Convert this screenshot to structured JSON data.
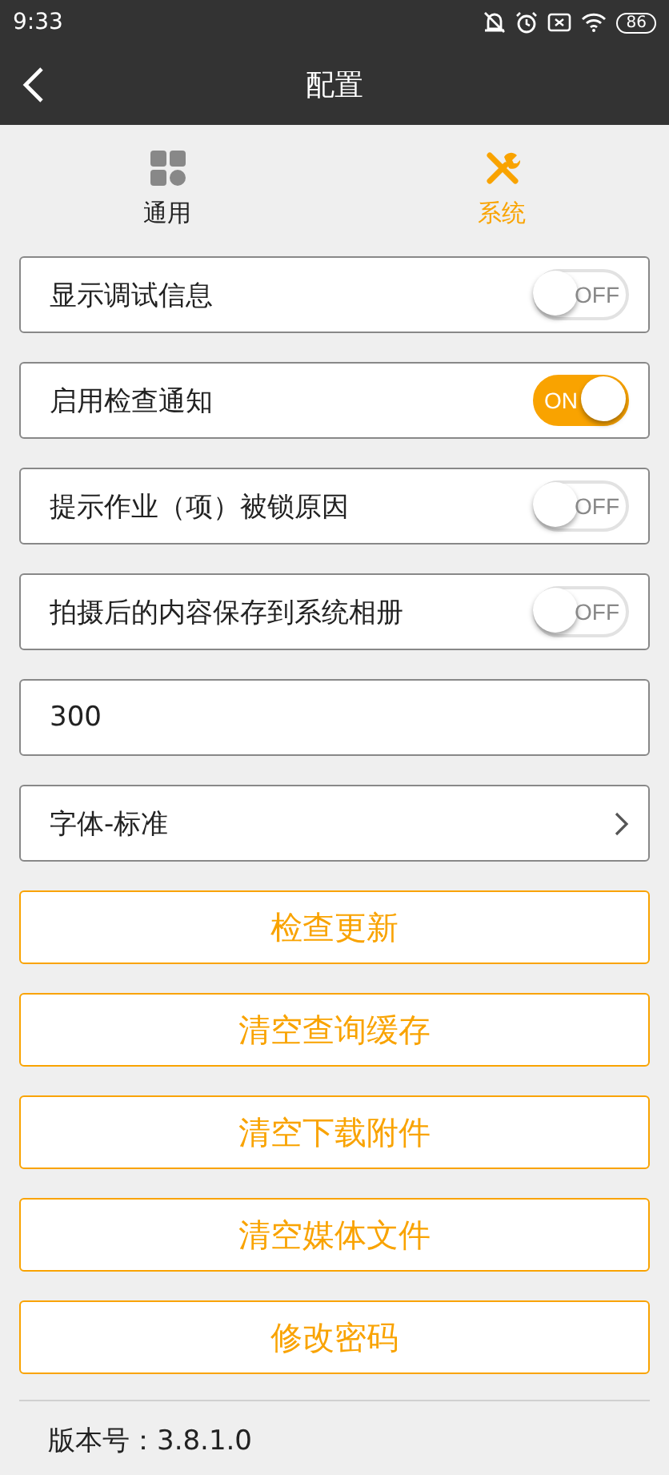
{
  "status_bar": {
    "time": "9:33",
    "battery": "86"
  },
  "header": {
    "title": "配置"
  },
  "tabs": [
    {
      "label": "通用",
      "kind": "grid",
      "selected": false
    },
    {
      "label": "系统",
      "kind": "tools",
      "selected": true
    }
  ],
  "settings": [
    {
      "kind": "toggle",
      "label": "显示调试信息",
      "on": false,
      "state_text": "OFF"
    },
    {
      "kind": "toggle",
      "label": "启用检查通知",
      "on": true,
      "state_text": "ON"
    },
    {
      "kind": "toggle",
      "label": "提示作业（项）被锁原因",
      "on": false,
      "state_text": "OFF"
    },
    {
      "kind": "toggle",
      "label": "拍摄后的内容保存到系统相册",
      "on": false,
      "state_text": "OFF"
    },
    {
      "kind": "input",
      "value": "300"
    },
    {
      "kind": "nav",
      "label": "字体-标准"
    }
  ],
  "buttons": [
    "检查更新",
    "清空查询缓存",
    "清空下载附件",
    "清空媒体文件",
    "修改密码"
  ],
  "version": "版本号：3.8.1.0"
}
